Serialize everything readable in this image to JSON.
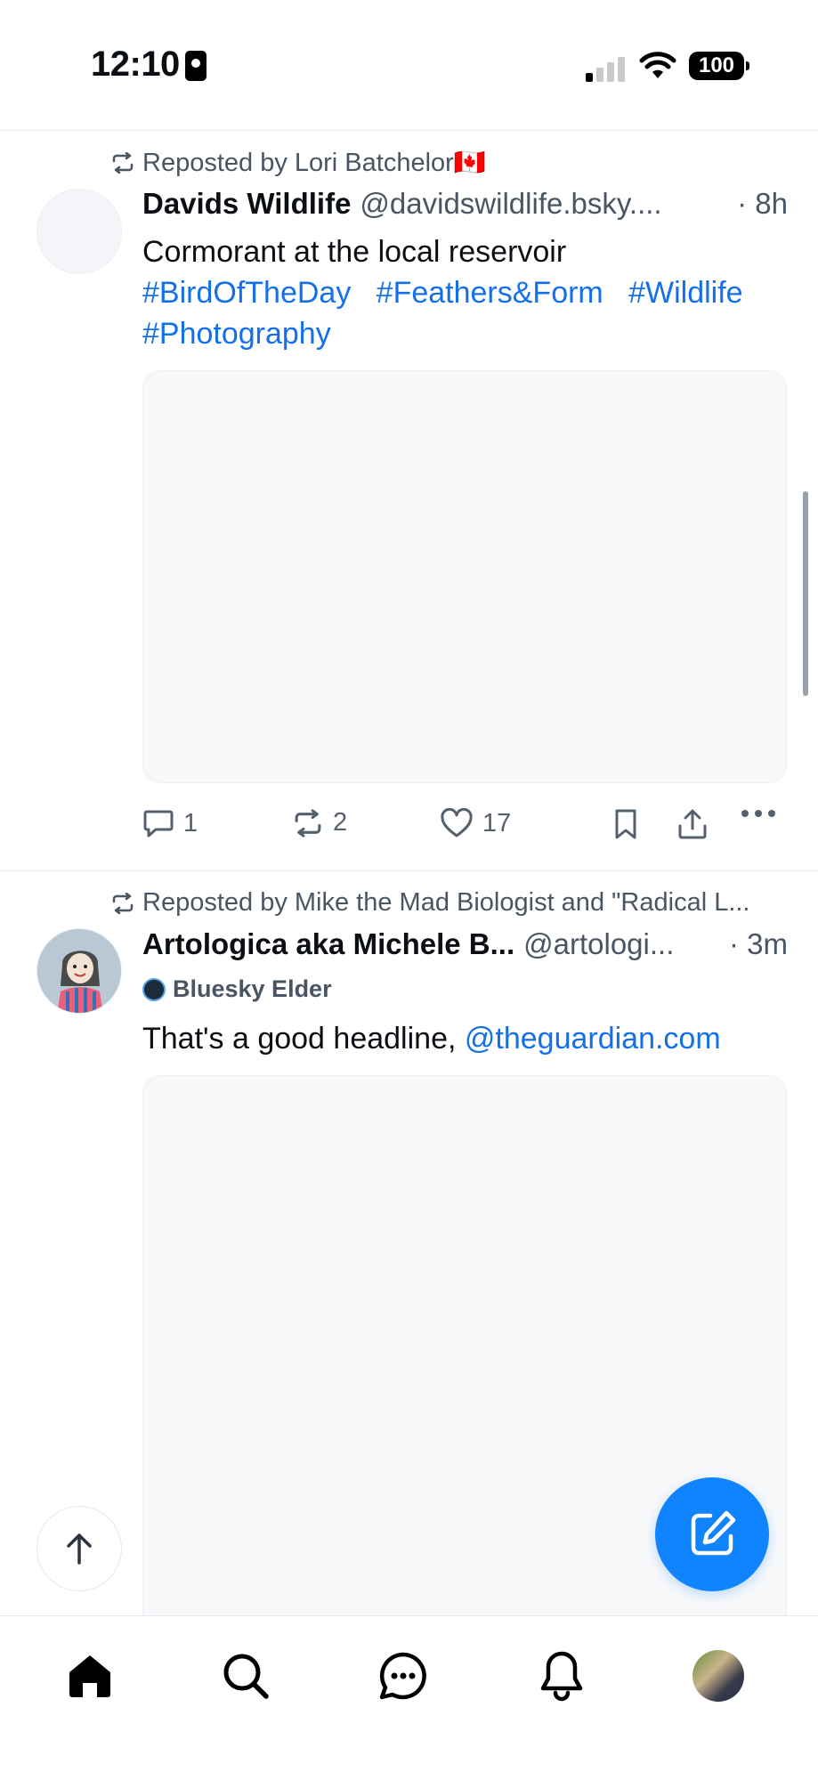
{
  "status_bar": {
    "time": "12:10",
    "battery": "100"
  },
  "posts": [
    {
      "repost_label": "Reposted by Lori Batchelor🇨🇦",
      "display_name": "Davids Wildlife",
      "handle": "@davidswildlife.bsky....",
      "time": "· 8h",
      "text": "Cormorant at the local reservoir",
      "hashtags": [
        "#BirdOfTheDay",
        "#Feathers&Form",
        "#Wildlife",
        "#Photography"
      ],
      "actions": {
        "replies": "1",
        "reposts": "2",
        "likes": "17"
      }
    },
    {
      "repost_label": "Reposted by Mike the Mad Biologist and \"Radical L...",
      "display_name": "Artologica aka Michele B...",
      "handle": "@artologi...",
      "time": "· 3m",
      "badge": "Bluesky Elder",
      "text_prefix": "That's a good headline, ",
      "mention": "@theguardian.com"
    }
  ],
  "icons": {
    "repost": "repost-icon",
    "reply": "reply-icon",
    "like": "heart-icon",
    "bookmark": "bookmark-icon",
    "share": "share-icon",
    "more": "more-icon",
    "compose": "compose-icon",
    "scroll_top": "arrow-up-icon",
    "tabs": [
      "home-icon",
      "search-icon",
      "chat-icon",
      "bell-icon",
      "profile-avatar"
    ]
  },
  "colors": {
    "accent": "#1083fe",
    "link": "#1470e8",
    "muted": "#4a5563"
  }
}
